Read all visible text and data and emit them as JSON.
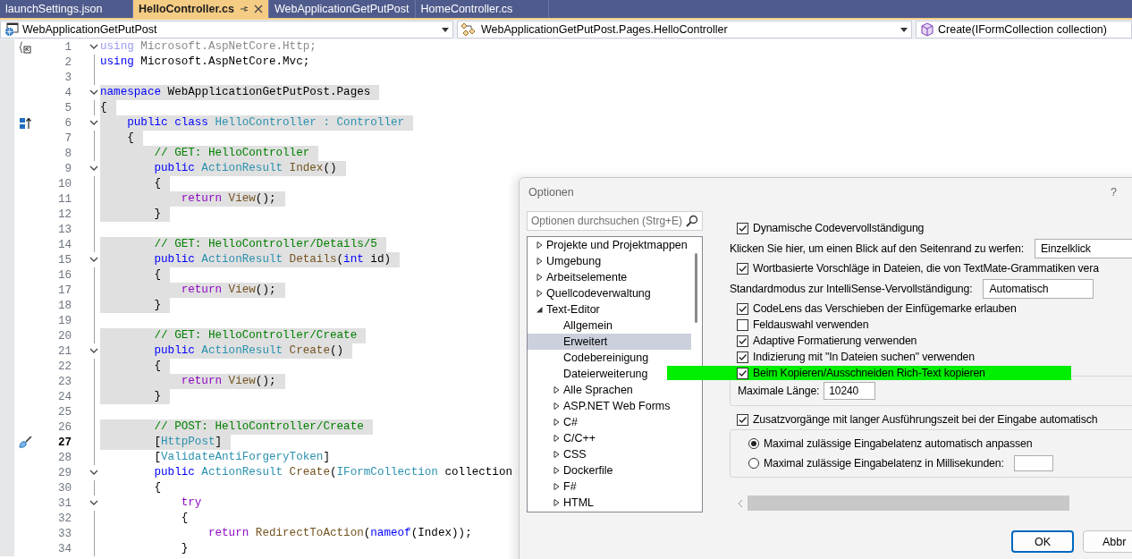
{
  "tabs": [
    {
      "label": "launchSettings.json",
      "selected": false
    },
    {
      "label": "HelloController.cs",
      "selected": true
    },
    {
      "label": "WebApplicationGetPutPost",
      "selected": false
    },
    {
      "label": "HomeController.cs",
      "selected": false
    }
  ],
  "nav_bar": [
    {
      "kind": "project",
      "value": "WebApplicationGetPutPost"
    },
    {
      "kind": "class",
      "value": "WebApplicationGetPutPost.Pages.HelloController"
    },
    {
      "kind": "member",
      "value": "Create(IFormCollection collection)"
    }
  ],
  "code_lines": [
    {
      "number": "1",
      "foldable": true,
      "highlighted": false,
      "current": false,
      "gutter_icon": {
        "kind": "usings"
      },
      "tokens": [
        {
          "kind": "faded-kw",
          "text": "using"
        },
        {
          "kind": "faded",
          "text": " Microsoft.AspNetCore.Http;"
        }
      ]
    },
    {
      "number": "2",
      "foldable": false,
      "highlighted": false,
      "current": false,
      "tokens": [
        {
          "kind": "kw",
          "text": "using"
        },
        {
          "kind": "plain",
          "text": " Microsoft.AspNetCore.Mvc;"
        }
      ]
    },
    {
      "number": "3",
      "foldable": false,
      "highlighted": false,
      "current": false
    },
    {
      "number": "4",
      "foldable": true,
      "highlighted": true,
      "current": false,
      "tokens": [
        {
          "kind": "kw",
          "text": "namespace"
        },
        {
          "kind": "plain",
          "text": " WebApplicationGetPutPost.Pages"
        }
      ]
    },
    {
      "number": "5",
      "foldable": false,
      "highlighted": true,
      "current": false,
      "tokens": [
        {
          "kind": "plain",
          "text": "{"
        }
      ]
    },
    {
      "number": "6",
      "foldable": true,
      "highlighted": true,
      "current": false,
      "gutter_icon": {
        "kind": "hierarchy"
      },
      "tokens": [
        {
          "kind": "kw",
          "text": "    public class"
        },
        {
          "kind": "type",
          "text": " HelloController : Controller"
        }
      ]
    },
    {
      "number": "7",
      "foldable": false,
      "highlighted": true,
      "current": false,
      "tokens": [
        {
          "kind": "plain",
          "text": "    {"
        }
      ]
    },
    {
      "number": "8",
      "foldable": false,
      "highlighted": true,
      "current": false,
      "tokens": [
        {
          "kind": "comment",
          "text": "        // GET: HelloController"
        }
      ]
    },
    {
      "number": "9",
      "foldable": true,
      "highlighted": true,
      "current": false,
      "tokens": [
        {
          "kind": "kw",
          "text": "        public"
        },
        {
          "kind": "type",
          "text": " ActionResult"
        },
        {
          "kind": "method",
          "text": " Index"
        },
        {
          "kind": "plain",
          "text": "()"
        }
      ]
    },
    {
      "number": "10",
      "foldable": false,
      "highlighted": true,
      "current": false,
      "tokens": [
        {
          "kind": "plain",
          "text": "        {"
        }
      ]
    },
    {
      "number": "11",
      "foldable": false,
      "highlighted": true,
      "current": false,
      "tokens": [
        {
          "kind": "ctrl",
          "text": "            return"
        },
        {
          "kind": "method",
          "text": " View"
        },
        {
          "kind": "plain",
          "text": "();"
        }
      ]
    },
    {
      "number": "12",
      "foldable": false,
      "highlighted": true,
      "current": false,
      "tokens": [
        {
          "kind": "plain",
          "text": "        }"
        }
      ]
    },
    {
      "number": "13",
      "foldable": false,
      "highlighted": false,
      "current": false
    },
    {
      "number": "14",
      "foldable": false,
      "highlighted": true,
      "current": false,
      "tokens": [
        {
          "kind": "comment",
          "text": "        // GET: HelloController/Details/5"
        }
      ]
    },
    {
      "number": "15",
      "foldable": true,
      "highlighted": true,
      "current": false,
      "tokens": [
        {
          "kind": "kw",
          "text": "        public"
        },
        {
          "kind": "type",
          "text": " ActionResult"
        },
        {
          "kind": "method",
          "text": " Details"
        },
        {
          "kind": "plain",
          "text": "("
        },
        {
          "kind": "kw",
          "text": "int"
        },
        {
          "kind": "plain",
          "text": " id)"
        }
      ]
    },
    {
      "number": "16",
      "foldable": false,
      "highlighted": true,
      "current": false,
      "tokens": [
        {
          "kind": "plain",
          "text": "        {"
        }
      ]
    },
    {
      "number": "17",
      "foldable": false,
      "highlighted": true,
      "current": false,
      "tokens": [
        {
          "kind": "ctrl",
          "text": "            return"
        },
        {
          "kind": "method",
          "text": " View"
        },
        {
          "kind": "plain",
          "text": "();"
        }
      ]
    },
    {
      "number": "18",
      "foldable": false,
      "highlighted": true,
      "current": false,
      "tokens": [
        {
          "kind": "plain",
          "text": "        }"
        }
      ]
    },
    {
      "number": "19",
      "foldable": false,
      "highlighted": false,
      "current": false
    },
    {
      "number": "20",
      "foldable": false,
      "highlighted": true,
      "current": false,
      "tokens": [
        {
          "kind": "comment",
          "text": "        // GET: HelloController/Create"
        }
      ]
    },
    {
      "number": "21",
      "foldable": true,
      "highlighted": true,
      "current": false,
      "tokens": [
        {
          "kind": "kw",
          "text": "        public"
        },
        {
          "kind": "type",
          "text": " ActionResult"
        },
        {
          "kind": "method",
          "text": " Create"
        },
        {
          "kind": "plain",
          "text": "()"
        }
      ]
    },
    {
      "number": "22",
      "foldable": false,
      "highlighted": true,
      "current": false,
      "tokens": [
        {
          "kind": "plain",
          "text": "        {"
        }
      ]
    },
    {
      "number": "23",
      "foldable": false,
      "highlighted": true,
      "current": false,
      "tokens": [
        {
          "kind": "ctrl",
          "text": "            return"
        },
        {
          "kind": "method",
          "text": " View"
        },
        {
          "kind": "plain",
          "text": "();"
        }
      ]
    },
    {
      "number": "24",
      "foldable": false,
      "highlighted": true,
      "current": false,
      "tokens": [
        {
          "kind": "plain",
          "text": "        }"
        }
      ]
    },
    {
      "number": "25",
      "foldable": false,
      "highlighted": false,
      "current": false
    },
    {
      "number": "26",
      "foldable": false,
      "highlighted": true,
      "current": false,
      "tokens": [
        {
          "kind": "comment",
          "text": "        // POST: HelloController/Create"
        }
      ]
    },
    {
      "number": "27",
      "foldable": false,
      "highlighted": true,
      "current": true,
      "gutter_icon": {
        "kind": "brush"
      },
      "tokens": [
        {
          "kind": "plain",
          "text": "        ["
        },
        {
          "kind": "type",
          "text": "HttpPost"
        },
        {
          "kind": "plain",
          "text": "]"
        }
      ]
    },
    {
      "number": "28",
      "foldable": false,
      "highlighted": false,
      "current": false,
      "tokens": [
        {
          "kind": "plain",
          "text": "        ["
        },
        {
          "kind": "type",
          "text": "ValidateAntiForgeryToken"
        },
        {
          "kind": "plain",
          "text": "]"
        }
      ]
    },
    {
      "number": "29",
      "foldable": true,
      "highlighted": false,
      "current": false,
      "tokens": [
        {
          "kind": "kw",
          "text": "        public"
        },
        {
          "kind": "type",
          "text": " ActionResult"
        },
        {
          "kind": "method",
          "text": " Create"
        },
        {
          "kind": "plain",
          "text": "("
        },
        {
          "kind": "type",
          "text": "IFormCollection"
        },
        {
          "kind": "plain",
          "text": " collection"
        }
      ]
    },
    {
      "number": "30",
      "foldable": false,
      "highlighted": false,
      "current": false,
      "tokens": [
        {
          "kind": "plain",
          "text": "        {"
        }
      ]
    },
    {
      "number": "31",
      "foldable": true,
      "highlighted": false,
      "current": false,
      "tokens": [
        {
          "kind": "ctrl",
          "text": "            try"
        }
      ]
    },
    {
      "number": "32",
      "foldable": false,
      "highlighted": false,
      "current": false,
      "tokens": [
        {
          "kind": "plain",
          "text": "            {"
        }
      ]
    },
    {
      "number": "33",
      "foldable": false,
      "highlighted": false,
      "current": false,
      "tokens": [
        {
          "kind": "ctrl",
          "text": "                return"
        },
        {
          "kind": "method",
          "text": " RedirectToAction"
        },
        {
          "kind": "plain",
          "text": "("
        },
        {
          "kind": "kw",
          "text": "nameof"
        },
        {
          "kind": "plain",
          "text": "(Index));"
        }
      ]
    },
    {
      "number": "34",
      "foldable": false,
      "highlighted": false,
      "current": false,
      "tokens": [
        {
          "kind": "plain",
          "text": "            }"
        }
      ]
    }
  ],
  "dialog": {
    "title": "Optionen",
    "help": "?",
    "search": {
      "placeholder": "Optionen durchsuchen (Strg+E)"
    },
    "tree": [
      {
        "label": "Projekte und Projektmappen",
        "expandable": true,
        "expanded": false,
        "selected": false
      },
      {
        "label": "Umgebung",
        "expandable": true,
        "expanded": false,
        "selected": false
      },
      {
        "label": "Arbeitselemente",
        "expandable": true,
        "expanded": false,
        "selected": false
      },
      {
        "label": "Quellcodeverwaltung",
        "expandable": true,
        "expanded": false,
        "selected": false
      },
      {
        "label": "Text-Editor",
        "expandable": true,
        "expanded": true,
        "selected": false,
        "children": [
          {
            "label": "Allgemein",
            "expandable": false,
            "expanded": false,
            "selected": false
          },
          {
            "label": "Erweitert",
            "expandable": false,
            "expanded": false,
            "selected": true
          },
          {
            "label": "Codebereinigung",
            "expandable": false,
            "expanded": false,
            "selected": false
          },
          {
            "label": "Dateierweiterung",
            "expandable": false,
            "expanded": false,
            "selected": false
          },
          {
            "label": "Alle Sprachen",
            "expandable": true,
            "expanded": false,
            "selected": false
          },
          {
            "label": "ASP.NET Web Forms",
            "expandable": true,
            "expanded": false,
            "selected": false
          },
          {
            "label": "C#",
            "expandable": true,
            "expanded": false,
            "selected": false
          },
          {
            "label": "C/C++",
            "expandable": true,
            "expanded": false,
            "selected": false
          },
          {
            "label": "CSS",
            "expandable": true,
            "expanded": false,
            "selected": false
          },
          {
            "label": "Dockerfile",
            "expandable": true,
            "expanded": false,
            "selected": false
          },
          {
            "label": "F#",
            "expandable": true,
            "expanded": false,
            "selected": false
          },
          {
            "label": "HTML",
            "expandable": true,
            "expanded": false,
            "selected": false
          }
        ]
      }
    ],
    "options": [
      {
        "kind": "checkbox",
        "label": "Dynamische Codevervollständigung",
        "checked": true,
        "highlighted": false
      },
      {
        "kind": "combo",
        "label": "Klicken Sie hier, um einen Blick auf den Seitenrand zu werfen:",
        "value": "Einzelklick"
      },
      {
        "kind": "checkbox",
        "label": "Wortbasierte Vorschläge in Dateien, die von TextMate-Grammatiken vera",
        "checked": true,
        "highlighted": false
      },
      {
        "kind": "combo",
        "label": "Standardmodus zur IntelliSense-Vervollständigung:",
        "value": "Automatisch"
      },
      {
        "kind": "checkbox",
        "label": "CodeLens das Verschieben der Einfügemarke erlauben",
        "checked": true,
        "highlighted": false
      },
      {
        "kind": "checkbox",
        "label": "Feldauswahl verwenden",
        "checked": false,
        "highlighted": false
      },
      {
        "kind": "checkbox",
        "label": "Adaptive Formatierung verwenden",
        "checked": true,
        "highlighted": false
      },
      {
        "kind": "checkbox",
        "label": "Indizierung mit \"In Dateien suchen\" verwenden",
        "checked": true,
        "highlighted": false
      },
      {
        "kind": "checkbox",
        "label": "Beim Kopieren/Ausschneiden Rich-Text kopieren",
        "checked": true,
        "highlighted": true,
        "children": [
          {
            "kind": "number",
            "label": "Maximale Länge:",
            "value": "10240"
          }
        ]
      },
      {
        "kind": "checkbox",
        "label": "Zusatzvorgänge mit langer Ausführungszeit bei der Eingabe automatisch",
        "checked": true,
        "highlighted": false,
        "children": [
          {
            "kind": "radio",
            "label": "Maximal zulässige Eingabelatenz automatisch anpassen",
            "selected": true
          },
          {
            "kind": "radio-field",
            "label": "Maximal zulässige Eingabelatenz in Millisekunden:",
            "selected": false
          }
        ]
      }
    ],
    "buttons": [
      "OK",
      "Abbr"
    ]
  }
}
